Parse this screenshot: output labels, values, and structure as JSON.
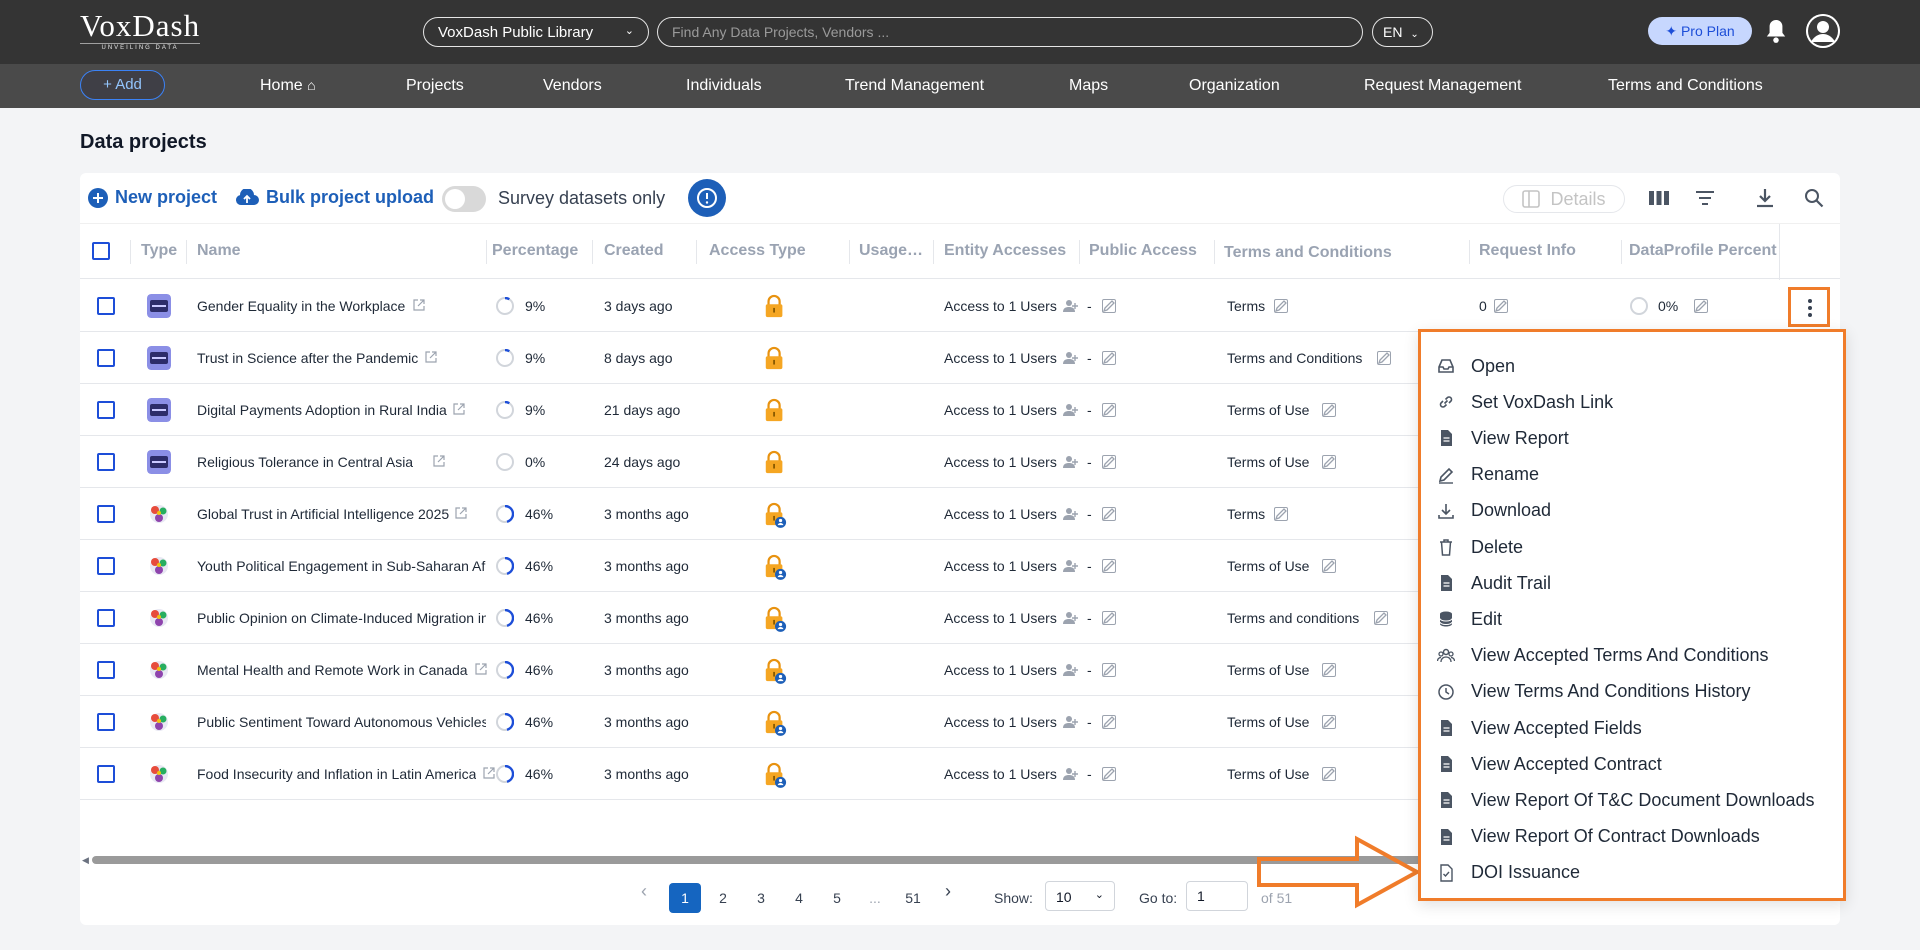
{
  "header": {
    "logo_main": "VoxDash",
    "logo_tagline": "UNVEILING DATA",
    "library_select": "VoxDash Public Library",
    "search_placeholder": "Find Any Data Projects, Vendors ...",
    "language": "EN",
    "pro_plan": "Pro Plan"
  },
  "nav": {
    "add_label": "Add",
    "items": [
      "Home",
      "Projects",
      "Vendors",
      "Individuals",
      "Trend Management",
      "Maps",
      "Organization",
      "Request Management",
      "Terms and Conditions"
    ]
  },
  "page": {
    "title": "Data projects"
  },
  "toolbar": {
    "new_project": "New project",
    "bulk_upload": "Bulk project upload",
    "survey_toggle_label": "Survey datasets only",
    "details": "Details"
  },
  "table": {
    "columns": [
      "Type",
      "Name",
      "Percentage",
      "Created",
      "Access Type",
      "Usage…",
      "Entity Accesses",
      "Public Access",
      "Terms and Conditions",
      "Request Info",
      "DataProfile Percent"
    ],
    "rows": [
      {
        "type": "survey",
        "name": "Gender Equality in the Workplace",
        "percentage": "9%",
        "created": "3 days ago",
        "access": "lock",
        "entity": "Access to 1 Users",
        "public": "-",
        "terms": "Terms",
        "request": "0",
        "profile": "0%"
      },
      {
        "type": "survey",
        "name": "Trust in Science after the Pandemic",
        "percentage": "9%",
        "created": "8 days ago",
        "access": "lock",
        "entity": "Access to 1 Users",
        "public": "-",
        "terms": "Terms and Conditions",
        "request": "",
        "profile": ""
      },
      {
        "type": "survey",
        "name": "Digital Payments Adoption in Rural India",
        "percentage": "9%",
        "created": "21 days ago",
        "access": "lock",
        "entity": "Access to 1 Users",
        "public": "-",
        "terms": "Terms of Use",
        "request": "",
        "profile": ""
      },
      {
        "type": "survey",
        "name": "Religious Tolerance in Central Asia",
        "percentage": "0%",
        "created": "24 days ago",
        "access": "lock",
        "entity": "Access to 1 Users",
        "public": "-",
        "terms": "Terms of Use",
        "request": "",
        "profile": ""
      },
      {
        "type": "globe",
        "name": "Global Trust in Artificial Intelligence 2025",
        "percentage": "46%",
        "created": "3 months ago",
        "access": "lock-user",
        "entity": "Access to 1 Users",
        "public": "-",
        "terms": "Terms",
        "request": "",
        "profile": ""
      },
      {
        "type": "globe",
        "name": "Youth Political Engagement in Sub-Saharan Afr",
        "percentage": "46%",
        "created": "3 months ago",
        "access": "lock-user",
        "entity": "Access to 1 Users",
        "public": "-",
        "terms": "Terms of Use",
        "request": "",
        "profile": ""
      },
      {
        "type": "globe",
        "name": "Public Opinion on Climate-Induced Migration in",
        "percentage": "46%",
        "created": "3 months ago",
        "access": "lock-user",
        "entity": "Access to 1 Users",
        "public": "-",
        "terms": "Terms and conditions",
        "request": "",
        "profile": ""
      },
      {
        "type": "globe",
        "name": "Mental Health and Remote Work in Canada",
        "percentage": "46%",
        "created": "3 months ago",
        "access": "lock-user",
        "entity": "Access to 1 Users",
        "public": "-",
        "terms": "Terms of Use",
        "request": "",
        "profile": ""
      },
      {
        "type": "globe",
        "name": "Public Sentiment Toward Autonomous Vehicles",
        "percentage": "46%",
        "created": "3 months ago",
        "access": "lock-user",
        "entity": "Access to 1 Users",
        "public": "-",
        "terms": "Terms of Use",
        "request": "",
        "profile": ""
      },
      {
        "type": "globe",
        "name": "Food Insecurity and Inflation in Latin America",
        "percentage": "46%",
        "created": "3 months ago",
        "access": "lock-user",
        "entity": "Access to 1 Users",
        "public": "-",
        "terms": "Terms of Use",
        "request": "",
        "profile": ""
      }
    ]
  },
  "pagination": {
    "pages": [
      "1",
      "2",
      "3",
      "4",
      "5",
      "...",
      "51"
    ],
    "current": "1",
    "show_label": "Show:",
    "show_value": "10",
    "goto_label": "Go to:",
    "goto_value": "1",
    "of_total": "of 51"
  },
  "context_menu": {
    "items": [
      {
        "label": "Open",
        "icon": "inbox-icon"
      },
      {
        "label": "Set VoxDash Link",
        "icon": "link-icon"
      },
      {
        "label": "View Report",
        "icon": "document-icon"
      },
      {
        "label": "Rename",
        "icon": "pencil-icon"
      },
      {
        "label": "Download",
        "icon": "download-icon"
      },
      {
        "label": "Delete",
        "icon": "trash-icon"
      },
      {
        "label": "Audit Trail",
        "icon": "document-icon"
      },
      {
        "label": "Edit",
        "icon": "database-icon"
      },
      {
        "label": "View Accepted Terms And Conditions",
        "icon": "group-icon"
      },
      {
        "label": "View Terms And Conditions History",
        "icon": "clock-icon"
      },
      {
        "label": "View Accepted Fields",
        "icon": "document-icon"
      },
      {
        "label": "View Accepted Contract",
        "icon": "document-icon"
      },
      {
        "label": "View Report Of T&C Document Downloads",
        "icon": "document-icon"
      },
      {
        "label": "View Report Of Contract Downloads",
        "icon": "document-icon"
      },
      {
        "label": "DOI Issuance",
        "icon": "doi-file-icon"
      }
    ]
  },
  "colors": {
    "accent": "#1d5fb8",
    "highlight": "#f07c2a",
    "topbar": "#343434",
    "navbar": "#4a4a4a",
    "lock": "#f5a623"
  }
}
